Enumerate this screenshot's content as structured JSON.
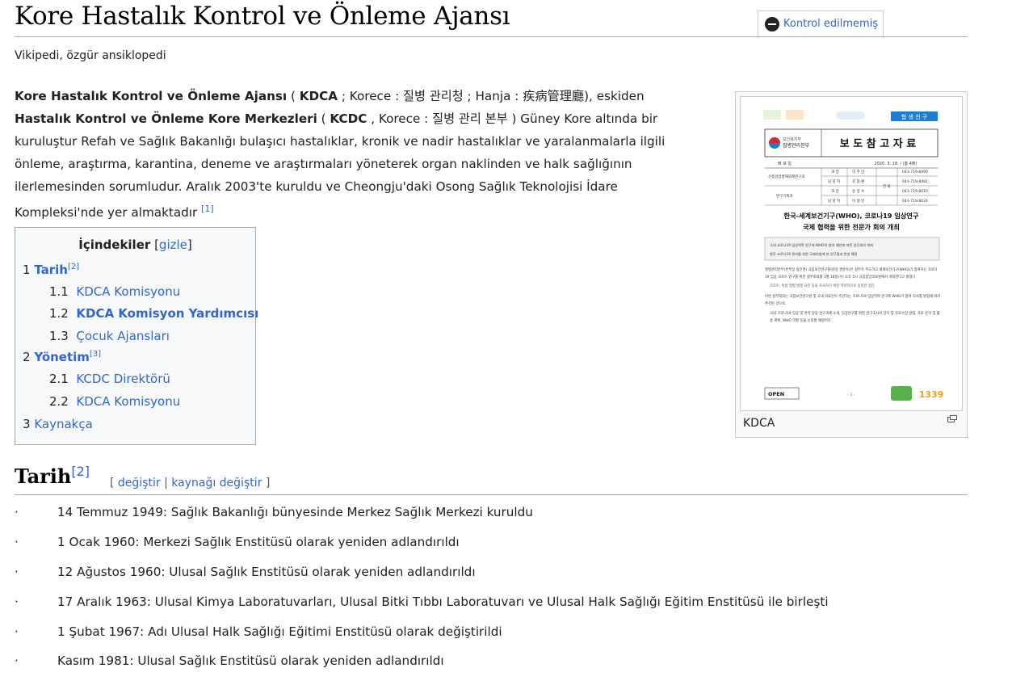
{
  "page": {
    "title": "Kore Hastalık Kontrol ve Önleme Ajansı",
    "tagline": "Vikipedi, özgür ansiklopedi",
    "review_flag": "Kontrol edilmemiş"
  },
  "intro": {
    "p1_name": "Kore Hastalık Kontrol ve Önleme Ajansı",
    "p1_open": " ( ",
    "p1_abbr": "KDCA",
    "p1_korean_label": " ; Korece : ",
    "p1_korean": "질병 관리청",
    "p1_hanja_label": " ; Hanja : ",
    "p1_hanja": "疾病管理廳",
    "p1_formerly": "), eskiden ",
    "p2_name": "Hastalık Kontrol ve Önleme Kore Merkezleri",
    "p2_open": " ( ",
    "p2_abbr": "KCDC",
    "p2_korean_label": " , Korece : ",
    "p2_korean": "질병 관리 본부",
    "p2_rest": " ) Güney Kore altında bir kuruluştur Refah ve Sağlık Bakanlığı bulaşıcı hastalıklar, kronik ve nadir hastalıklar ve yaralanmalarla ilgili önleme, araştırma, karantina, deneme ve araştırmaları yöneterek organ naklinden ve halk sağlığının ilerlemesinden sorumludur. Aralık 2003'te kuruldu ve Cheongju'daki Osong Sağlık Teknolojisi İdare Kompleksi'nde yer almaktadır ",
    "ref": "[1]"
  },
  "toc": {
    "title": "İçindekiler",
    "hide_open": "[",
    "hide": "gizle",
    "hide_close": "]",
    "items": [
      {
        "num": "1",
        "label": "Tarih",
        "sup": "[2]"
      },
      {
        "num": "1.1",
        "label": "KDCA Komisyonu"
      },
      {
        "num": "1.2",
        "label": "KDCA Komisyon Yardımcısı"
      },
      {
        "num": "1.3",
        "label": "Çocuk Ajansları"
      },
      {
        "num": "2",
        "label": "Yönetim",
        "sup": "[3]"
      },
      {
        "num": "2.1",
        "label": "KCDC Direktörü"
      },
      {
        "num": "2.2",
        "label": "KDCA Komisyonu"
      },
      {
        "num": "3",
        "label": "Kaynakça"
      }
    ]
  },
  "thumb": {
    "caption": "KDCA",
    "doc": {
      "tag": "협 생 친 구",
      "heading": "보 도 참 고 자 료",
      "agency_small": "보건복지부",
      "agency": "질병관리본부",
      "date": "2020. 3. 18. / (총 4매)",
      "date_label": "배 포 일",
      "dept1": "신종감염병해외제한구과",
      "dept2": "연구기획과",
      "role1": "과 장",
      "role2": "담 당 자",
      "name1": "이 주 민",
      "name2": "김 광 환",
      "name3": "송 양 수",
      "name4": "이 형 빈",
      "contact_label": "전 화",
      "phone1": "043-719-8490",
      "phone2": "043-719-8481",
      "phone3": "043-719-8010",
      "phone4": "043-719-8024",
      "headline1": "한국-세계보건기구(WHO), 코로나19 임상연구",
      "headline2": "국제 협력을 위한 전문가 회의 개최",
      "summary1": "국내 코로나19 임상역학 연구에 WHO의 참여 제안에 따른 실무회의 개최",
      "summary2": "향후 코로나19 관리를 위한 국제지침에 본 연구결과 반영 예정",
      "body1": "질병관리본부(본부장 정은경) 국립보건연구원(원장 권준욱)은 정부가 주도하고 세계보건기구(WHO)가 참여하는 코로나19 임상 코호트 연구를 위한 실무회의를 3월 18일(수) 오후 5시 국립중앙의료원에서 개최한다고 밝혔다.",
      "body2": "코호트: 특정 질병 발생 요인 등을 조사하기 위한 역학적으로 동일한 집단",
      "body3": "이번 실무회의는 국립보건연구원 및 국내 의료진이 주관하는 코로나19 임상역학 연구에 WHO가 참여 의사를 밝힘에 따라 추진된 것으로,",
      "body4": "국내 코로나19 임상 및 면역 양상 연구과제 소개, 임상연구를 위한 연구조사서 양식 및 자료수집 방법, 자료 분석 및 활용 계획, WHO 역할 등을 논의할 예정이다.",
      "open_label": "OPEN",
      "page_no": "- 1 -",
      "hotline": "1339"
    }
  },
  "section": {
    "heading": "Tarih",
    "sup": "[2]",
    "edit_open": "[ ",
    "edit": "değiştir",
    "sep": " | ",
    "edit_source": "kaynağı değiştir",
    "edit_close": " ]",
    "bullet": "·",
    "history": [
      "14 Temmuz 1949: Sağlık Bakanlığı bünyesinde Merkez Sağlık Merkezi kuruldu",
      "1 Ocak 1960: Merkezi Sağlık Enstitüsü olarak yeniden adlandırıldı",
      "12 Ağustos 1960: Ulusal Sağlık Enstitüsü olarak yeniden adlandırıldı",
      "17 Aralık 1963: Ulusal Kimya Laboratuvarları, Ulusal Bitki Tıbbı Laboratuvarı ve Ulusal Halk Sağlığı Eğitim Enstitüsü ile birleşti",
      "1 Şubat 1967: Adı Ulusal Halk Sağlığı Eğitimi Enstitüsü olarak değiştirildi",
      "Kasım 1981: Ulusal Sağlık Enstitüsü olarak yeniden adlandırıldı"
    ]
  },
  "colors": {
    "link": "#3366cc",
    "text": "#202122",
    "rule": "#a2a9b1",
    "doc_accent": "#1a7fd0"
  }
}
